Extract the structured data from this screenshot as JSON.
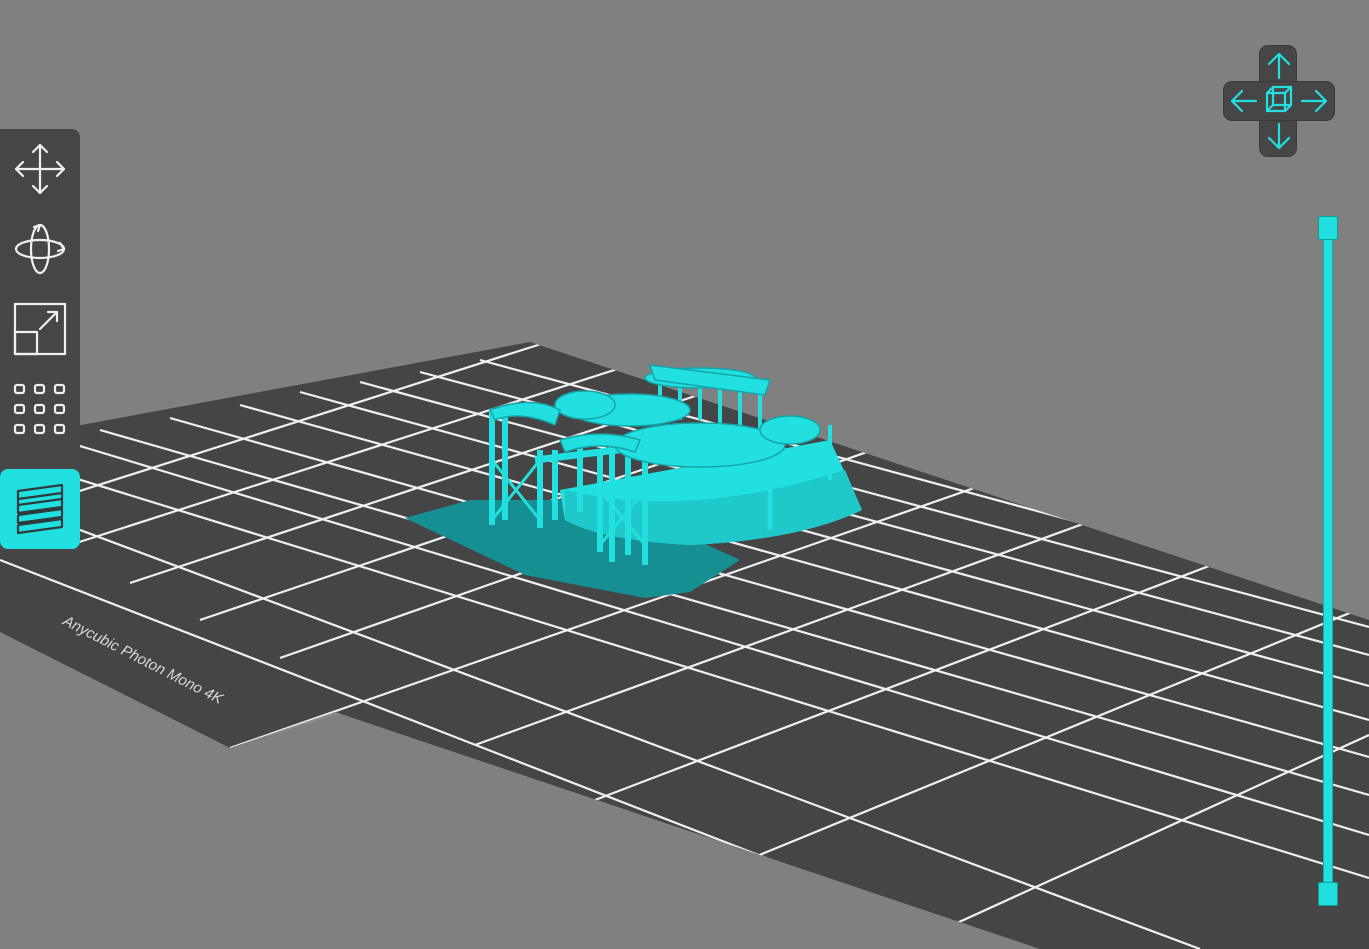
{
  "viewport": {
    "printer_name": "Anycubic Photon Mono 4K",
    "model_color": "#22e0e0",
    "build_plate_color": "#454545",
    "background_color": "#808080"
  },
  "toolbar": {
    "tools": [
      {
        "name": "move-tool",
        "icon": "move-arrows-icon",
        "active": false
      },
      {
        "name": "rotate-tool",
        "icon": "rotate-icon",
        "active": false
      },
      {
        "name": "scale-tool",
        "icon": "scale-icon",
        "active": false
      },
      {
        "name": "arrange-tool",
        "icon": "grid-dots-icon",
        "active": false
      },
      {
        "name": "layers-tool",
        "icon": "layers-icon",
        "active": true
      }
    ]
  },
  "view_nav": {
    "buttons": [
      "view-up-arrow-icon",
      "view-left-arrow-icon",
      "view-right-arrow-icon",
      "view-down-arrow-icon",
      "view-cube-icon"
    ]
  },
  "layer_slider": {
    "accent": "#22e0e0",
    "top_position": 1.0,
    "bottom_position": 0.0
  }
}
